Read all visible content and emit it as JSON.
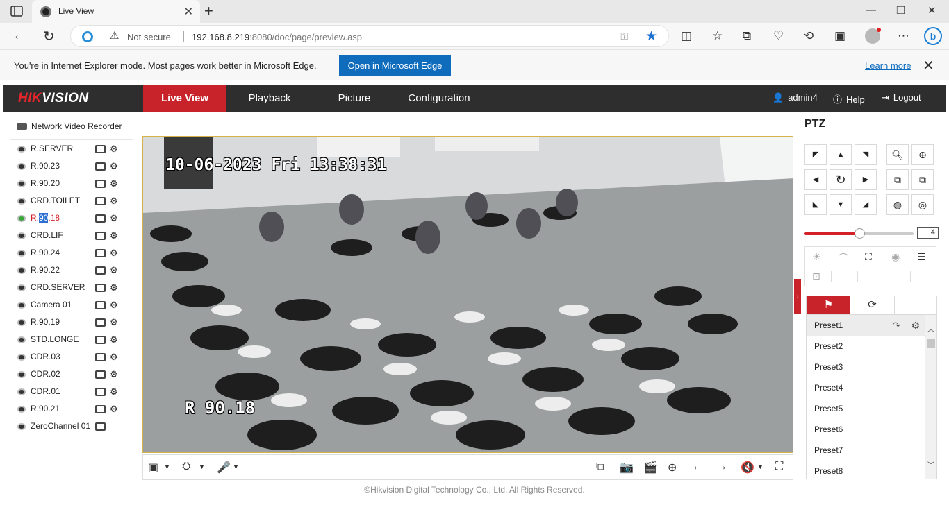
{
  "browser": {
    "tab_title": "Live View",
    "not_secure": "Not secure",
    "url_host": "192.168.8.219",
    "url_rest": ":8080/doc/page/preview.asp",
    "ie_message": "You're in Internet Explorer mode. Most pages work better in Microsoft Edge.",
    "open_edge": "Open in Microsoft Edge",
    "learn_more": "Learn more"
  },
  "header": {
    "logo_hik": "HIK",
    "logo_vision": "VISION",
    "tabs": [
      {
        "label": "Live View"
      },
      {
        "label": "Playback"
      },
      {
        "label": "Picture"
      },
      {
        "label": "Configuration"
      }
    ],
    "user": "admin4",
    "help": "Help",
    "logout": "Logout"
  },
  "tree": {
    "root": "Network Video Recorder",
    "cameras": [
      {
        "name": "R.SERVER"
      },
      {
        "name": "R.90.23"
      },
      {
        "name": "R.90.20"
      },
      {
        "name": "CRD.TOILET"
      },
      {
        "name_pre": "R.",
        "name_hl": "90",
        "name_post": ".18"
      },
      {
        "name": "CRD.LIF"
      },
      {
        "name": "R.90.24"
      },
      {
        "name": "R.90.22"
      },
      {
        "name": "CRD.SERVER"
      },
      {
        "name": "Camera 01"
      },
      {
        "name": "R.90.19"
      },
      {
        "name": "STD.LONGE"
      },
      {
        "name": "CDR.03"
      },
      {
        "name": "CDR.02"
      },
      {
        "name": "CDR.01"
      },
      {
        "name": "R.90.21"
      },
      {
        "name": "ZeroChannel 01"
      }
    ]
  },
  "video": {
    "osd_time": "10-06-2023 Fri 13:38:31",
    "osd_channel": "R 90.18"
  },
  "ptz": {
    "title": "PTZ",
    "speed": "4",
    "speed_fraction": 0.5,
    "presets": [
      "Preset1",
      "Preset2",
      "Preset3",
      "Preset4",
      "Preset5",
      "Preset6",
      "Preset7",
      "Preset8"
    ]
  },
  "footer": "©Hikvision Digital Technology Co., Ltd. All Rights Reserved.",
  "colors": {
    "brand_red": "#c8232a",
    "edge_blue": "#0f6cbd",
    "nav_dark": "#2e2e2e"
  }
}
